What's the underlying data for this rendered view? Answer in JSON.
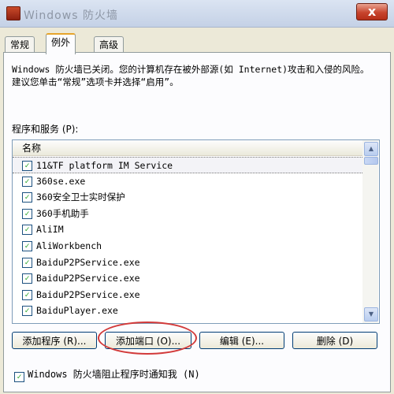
{
  "window": {
    "title": "Windows 防火墙",
    "close_label": "x"
  },
  "tabs": [
    {
      "label": "常规"
    },
    {
      "label": "例外"
    },
    {
      "label": "高级"
    }
  ],
  "description": "Windows 防火墙已关闭。您的计算机存在被外部源(如 Internet)攻击和入侵的风险。建议您单击“常规”选项卡并选择“启用”。",
  "programs": {
    "label": "程序和服务 (P):",
    "column_header": "名称",
    "items": [
      {
        "label": "11&TF platform IM Service",
        "checked": true
      },
      {
        "label": "360se.exe",
        "checked": true
      },
      {
        "label": "360安全卫士实时保护",
        "checked": true
      },
      {
        "label": "360手机助手",
        "checked": true
      },
      {
        "label": "AliIM",
        "checked": true
      },
      {
        "label": "AliWorkbench",
        "checked": true
      },
      {
        "label": "BaiduP2PService.exe",
        "checked": true
      },
      {
        "label": "BaiduP2PService.exe",
        "checked": true
      },
      {
        "label": "BaiduP2PService.exe",
        "checked": true
      },
      {
        "label": "BaiduPlayer.exe",
        "checked": true
      }
    ],
    "selected_index": 0
  },
  "buttons": {
    "add_program": "添加程序 (R)...",
    "add_port": "添加端口 (O)...",
    "edit": "编辑 (E)...",
    "delete": "删除 (D)"
  },
  "notify": {
    "label": "Windows 防火墙阻止程序时通知我 (N)",
    "checked": true
  },
  "accent": {
    "highlight_ring": "#d23a3a",
    "check_color": "#21a121"
  }
}
